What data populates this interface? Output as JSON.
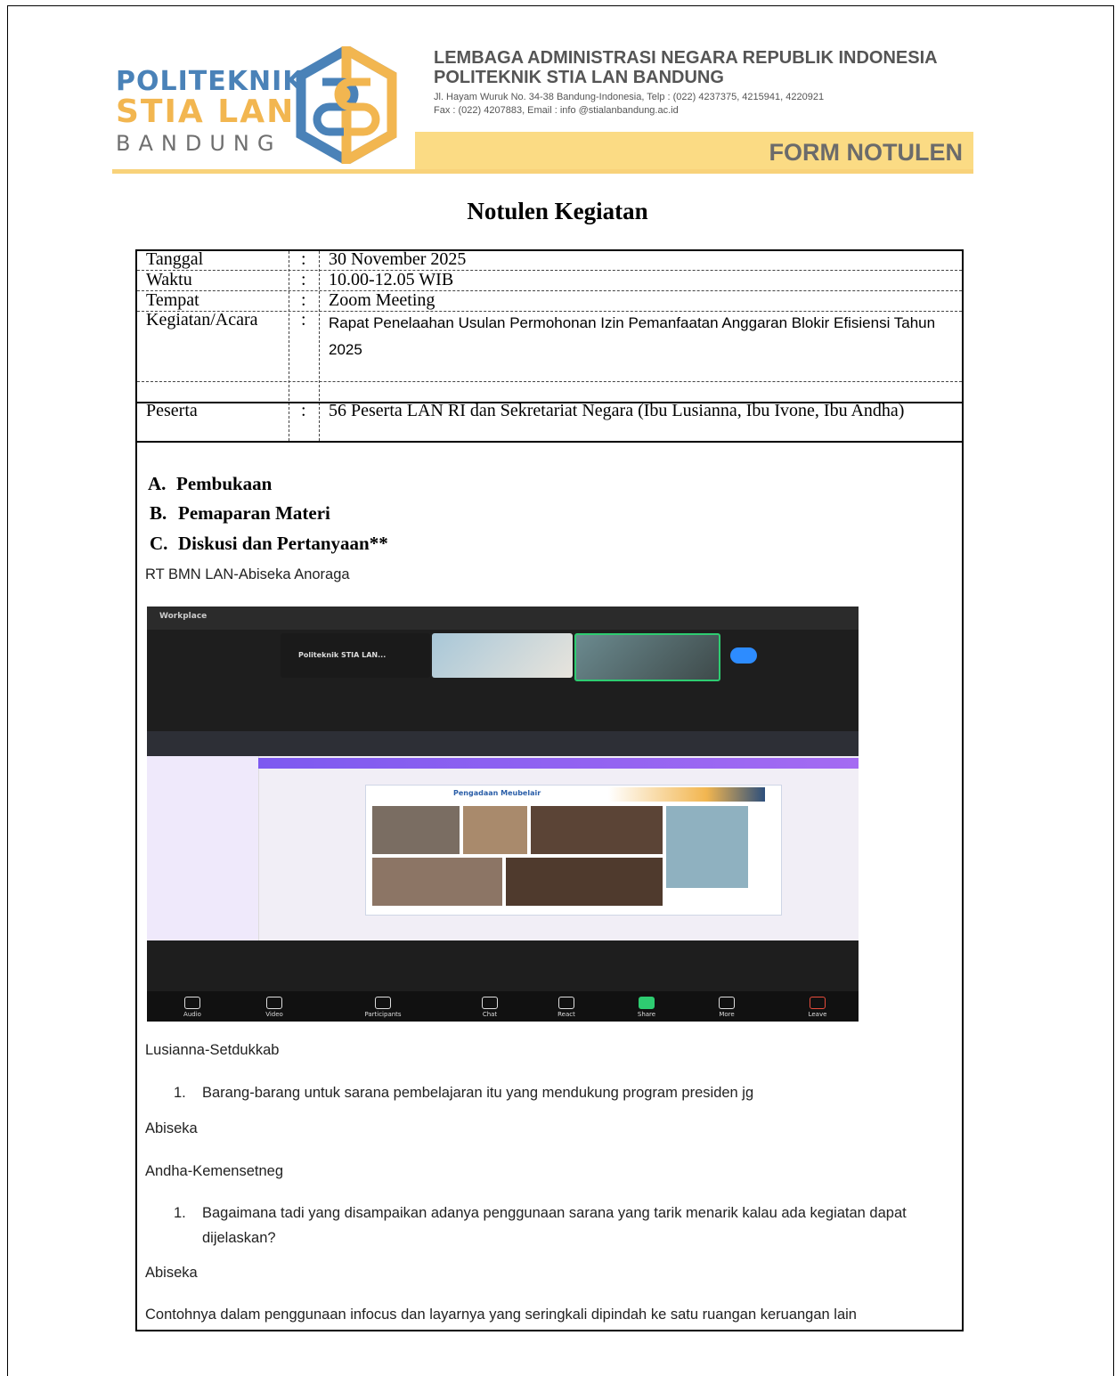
{
  "letterhead": {
    "logo_line1": "POLITEKNIK",
    "logo_line2": "STIA LAN",
    "logo_line3": "BANDUNG",
    "institution_line1": "LEMBAGA ADMINISTRASI NEGARA REPUBLIK INDONESIA",
    "institution_line2": "POLITEKNIK STIA LAN BANDUNG",
    "address": "Jl. Hayam Wuruk No. 34-38 Bandung-Indonesia, Telp : (022) 4237375, 4215941, 4220921",
    "contact": "Fax : (022) 4207883, Email : info @stialanbandung.ac.id",
    "form_label": "FORM NOTULEN",
    "colors": {
      "blue": "#4a82b8",
      "yellow": "#f2b650",
      "band": "#fbdb84"
    }
  },
  "title": "Notulen Kegiatan",
  "info": {
    "separator": ":",
    "rows": [
      {
        "label": "Tanggal",
        "value": "30 November 2025"
      },
      {
        "label": "Waktu",
        "value": "10.00-12.05 WIB"
      },
      {
        "label": "Tempat",
        "value": "Zoom Meeting"
      },
      {
        "label": "Kegiatan/Acara",
        "value": "Rapat Penelaahan Usulan Permohonan Izin Pemanfaatan Anggaran Blokir Efisiensi Tahun 2025"
      },
      {
        "label": "Peserta",
        "value": "56 Peserta LAN RI dan Sekretariat Negara (Ibu Lusianna, Ibu Ivone, Ibu Andha)"
      }
    ]
  },
  "sections": [
    {
      "letter": "A.",
      "title": "Pembukaan"
    },
    {
      "letter": "B.",
      "title": "Pemaparan Materi"
    },
    {
      "letter": "C.",
      "title": "Diskusi dan Pertanyaan**"
    }
  ],
  "discussion": {
    "speaker1": "RT BMN LAN-Abiseka Anoraga",
    "speaker2": "Lusianna-Setdukkab",
    "item1_num": "1.",
    "item1": "Barang-barang untuk sarana pembelajaran itu yang mendukung program presiden jg",
    "speaker3": "Abiseka",
    "speaker4": "Andha-Kemensetneg",
    "item2_num": "1.",
    "item2_line1": "Bagaimana tadi yang disampaikan adanya penggunaan sarana yang tarik menarik kalau ada kegiatan dapat",
    "item2_line2": "dijelaskan?",
    "speaker5": "Abiseka",
    "answer": "Contohnya dalam penggunaan infocus dan layarnya yang seringkali dipindah ke satu ruangan keruangan lain"
  },
  "zoom_screenshot": {
    "app": "Workplace",
    "thumb_label": "Politeknik STIA LAN...",
    "slide_title": "Pengadaan Meubelair",
    "toolbar": [
      "Audio",
      "Video",
      "Participants",
      "Chat",
      "React",
      "Share",
      "More",
      "Leave"
    ]
  }
}
